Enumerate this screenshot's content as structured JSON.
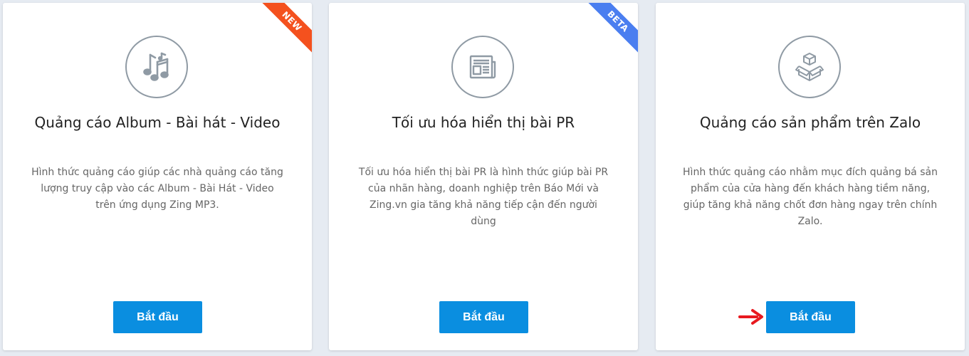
{
  "colors": {
    "accent": "#0a8ee0",
    "ribbon_new": "#f4511e",
    "ribbon_beta": "#4a7ef0",
    "arrow": "#e8191f"
  },
  "cards": [
    {
      "ribbon": "NEW",
      "icon": "music-notes-icon",
      "title": "Quảng cáo Album - Bài hát - Video",
      "description": "Hình thức quảng cáo giúp các nhà quảng cáo tăng lượng truy cập vào các Album - Bài Hát - Video trên ứng dụng Zing MP3.",
      "button_label": "Bắt đầu"
    },
    {
      "ribbon": "BETA",
      "icon": "newspaper-icon",
      "title": "Tối ưu hóa hiển thị bài PR",
      "description": "Tối ưu hóa hiển thị bài PR là hình thức giúp bài PR của nhãn hàng, doanh nghiệp trên Báo Mới và Zing.vn gia tăng khả năng tiếp cận đến người dùng",
      "button_label": "Bắt đầu"
    },
    {
      "icon": "package-box-icon",
      "title": "Quảng cáo sản phẩm trên Zalo",
      "description": "Hình thức quảng cáo nhằm mục đích quảng bá sản phẩm của cửa hàng đến khách hàng tiềm năng, giúp tăng khả năng chốt đơn hàng ngay trên chính Zalo.",
      "button_label": "Bắt đầu"
    }
  ],
  "annotation": {
    "icon": "red-arrow-icon"
  }
}
